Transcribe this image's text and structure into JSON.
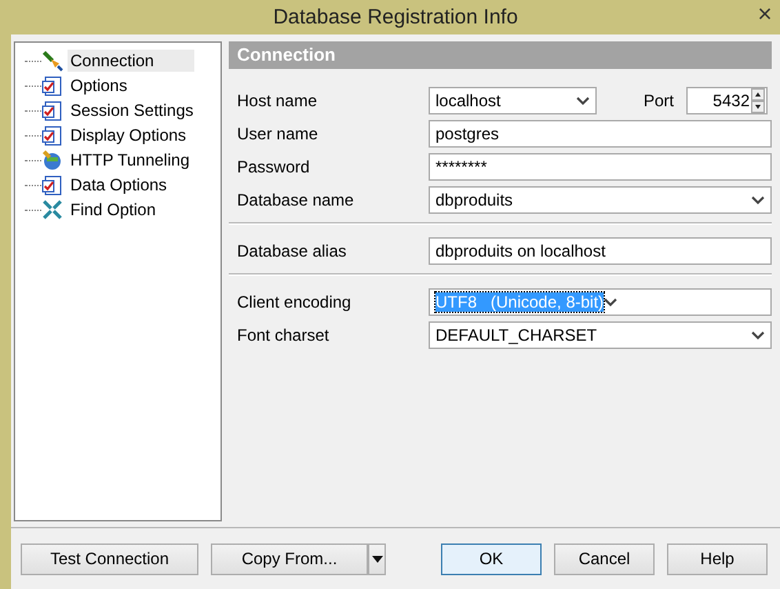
{
  "window": {
    "title": "Database Registration Info",
    "close": "×"
  },
  "tree": [
    {
      "label": "Connection",
      "selected": true
    },
    {
      "label": "Options",
      "selected": false
    },
    {
      "label": "Session Settings",
      "selected": false
    },
    {
      "label": "Display Options",
      "selected": false
    },
    {
      "label": "HTTP Tunneling",
      "selected": false
    },
    {
      "label": "Data Options",
      "selected": false
    },
    {
      "label": "Find Option",
      "selected": false
    }
  ],
  "section": {
    "title": "Connection"
  },
  "groups": [
    [
      {
        "label": "Host name",
        "kind": "combo",
        "value": "localhost",
        "port": {
          "label": "Port",
          "value": "5432"
        }
      },
      {
        "label": "User name",
        "kind": "text",
        "value": "postgres"
      },
      {
        "label": "Password",
        "kind": "text",
        "value": "********"
      },
      {
        "label": "Database name",
        "kind": "combo",
        "value": "dbproduits"
      }
    ],
    [
      {
        "label": "Database alias",
        "kind": "text",
        "value": "dbproduits on localhost"
      }
    ],
    [
      {
        "label": "Client encoding",
        "kind": "combo",
        "value": "UTF8   (Unicode, 8-bit)",
        "highlighted": true
      },
      {
        "label": "Font charset",
        "kind": "combo",
        "value": "DEFAULT_CHARSET",
        "highlighted": false
      }
    ]
  ],
  "buttons": {
    "test": "Test Connection",
    "copy": "Copy From...",
    "ok": "OK",
    "cancel": "Cancel",
    "help": "Help"
  }
}
